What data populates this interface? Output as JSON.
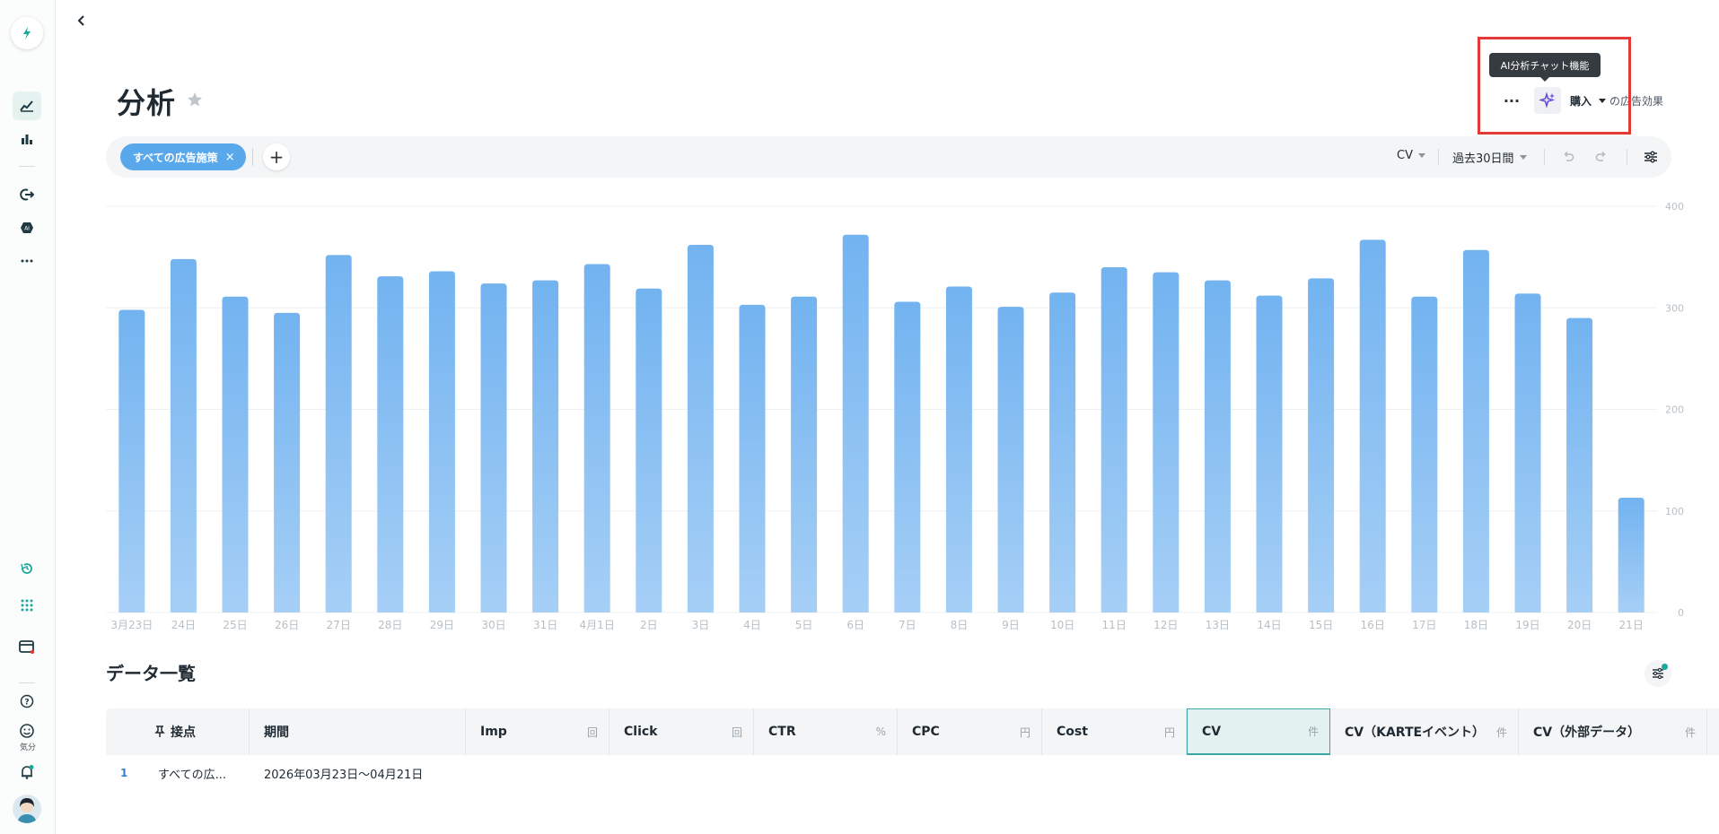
{
  "page": {
    "title": "分析"
  },
  "header": {
    "tooltip": "AI分析チャット機能",
    "more_label": "···",
    "event_label": "購入",
    "event_suffix": "の広告効果"
  },
  "sidebar": {
    "mood_label": "気分"
  },
  "filter_bar": {
    "chip_label": "すべての広告施策",
    "chip_close": "×",
    "add_label": "+",
    "metric": "CV",
    "range": "過去30日間"
  },
  "chart_data": {
    "type": "bar",
    "categories": [
      "3月23日",
      "24日",
      "25日",
      "26日",
      "27日",
      "28日",
      "29日",
      "30日",
      "31日",
      "4月1日",
      "2日",
      "3日",
      "4日",
      "5日",
      "6日",
      "7日",
      "8日",
      "9日",
      "10日",
      "11日",
      "12日",
      "13日",
      "14日",
      "15日",
      "16日",
      "17日",
      "18日",
      "19日",
      "20日",
      "21日"
    ],
    "values": [
      298,
      348,
      311,
      295,
      352,
      331,
      336,
      324,
      327,
      343,
      319,
      362,
      303,
      311,
      372,
      306,
      321,
      301,
      315,
      340,
      335,
      327,
      312,
      329,
      367,
      311,
      357,
      314,
      290,
      113
    ],
    "ylim": [
      0,
      400
    ],
    "yticks": [
      "0",
      "100",
      "200",
      "300",
      "400"
    ],
    "bar_color": "#7ab8f1",
    "grid": true,
    "axis_side": "right"
  },
  "data_list": {
    "title": "データ一覧",
    "columns": [
      {
        "label": "接点",
        "unit": ""
      },
      {
        "label": "期間",
        "unit": ""
      },
      {
        "label": "Imp",
        "unit": "回"
      },
      {
        "label": "Click",
        "unit": "回"
      },
      {
        "label": "CTR",
        "unit": "%"
      },
      {
        "label": "CPC",
        "unit": "円"
      },
      {
        "label": "Cost",
        "unit": "円"
      },
      {
        "label": "CV",
        "unit": "件"
      },
      {
        "label": "CV（KARTEイベント）",
        "unit": "件"
      },
      {
        "label": "CV（外部データ）",
        "unit": "件"
      }
    ],
    "rows": [
      {
        "num": "1",
        "touchpoint": "すべての広...",
        "period": "2026年03月23日〜04月21日"
      }
    ]
  },
  "colors": {
    "accent": "#19a89a",
    "chip": "#5aa8ec",
    "highlight": "#e53935",
    "ai_icon": "#6b4fd8"
  }
}
